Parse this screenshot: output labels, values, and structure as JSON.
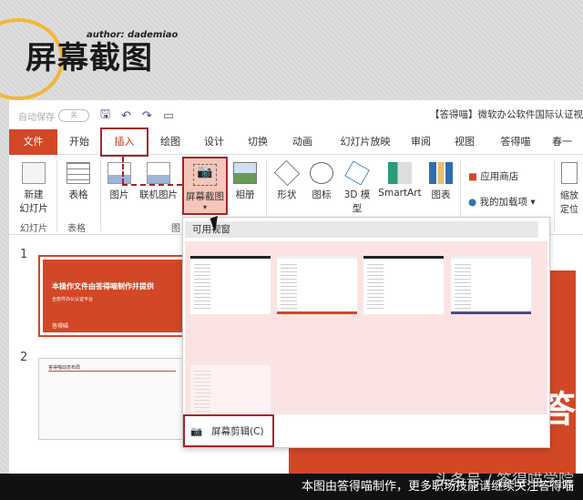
{
  "logo": {
    "title": "屏幕截图",
    "author": "author: dademiao"
  },
  "quick_access": {
    "autosave": "自动保存",
    "toggle": "关",
    "window_title": "【答得喵】微软办公软件国际认证视"
  },
  "tabs": [
    "文件",
    "开始",
    "插入",
    "绘图",
    "设计",
    "切换",
    "动画",
    "幻灯片放映",
    "审阅",
    "视图",
    "答得喵",
    "春一"
  ],
  "ribbon": {
    "new_slide": "新建\n幻灯片",
    "table": "表格",
    "picture": "图片",
    "online_picture": "联机图片",
    "screenshot": "屏幕截图",
    "album": "相册",
    "shapes": "形状",
    "icons": "图标",
    "model3d": "3D 模型",
    "smartart": "SmartArt",
    "chart": "图表",
    "app_store": "应用商店",
    "my_addins": "我的加载项",
    "zoom": "缩放定位",
    "groups": {
      "slides": "幻灯片",
      "tables": "表格",
      "images": "图"
    }
  },
  "dropdown": {
    "header": "可用视窗",
    "clip": "屏幕剪辑(C)"
  },
  "slides": [
    {
      "num": "1",
      "title": "本操作文件由答得喵制作并提供",
      "subtitle": "全软件办公认证平台",
      "brand": "答得喵"
    },
    {
      "num": "2",
      "title": "答得喵动态布局"
    }
  ],
  "main_slide": {
    "big_char": "答"
  },
  "footer": {
    "text": "本图由答得喵制作，更多职场技能请继续关注答得喵",
    "watermark": "头条号 / 答得喵学院"
  },
  "colors": {
    "accent": "#d24726",
    "highlight": "#a4262c"
  }
}
